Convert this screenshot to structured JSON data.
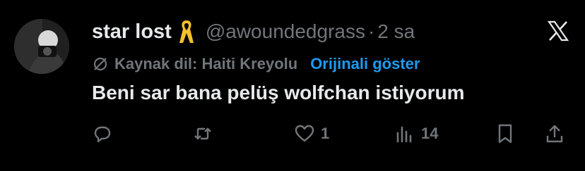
{
  "tweet": {
    "display_name": "star lost",
    "handle": "@awoundedgrass",
    "separator": "·",
    "time": "2 sa",
    "translation": {
      "source_label": "Kaynak dil: Haiti Kreyolu",
      "show_original": "Orijinali göster"
    },
    "text": "Beni sar bana pelüş wolfchan istiyorum",
    "likes": "1",
    "views": "14",
    "colors": {
      "background": "#000000",
      "text": "#e7e9ea",
      "muted": "#71767b",
      "link": "#1d9bf0",
      "ribbon": "#f4c02b"
    }
  }
}
